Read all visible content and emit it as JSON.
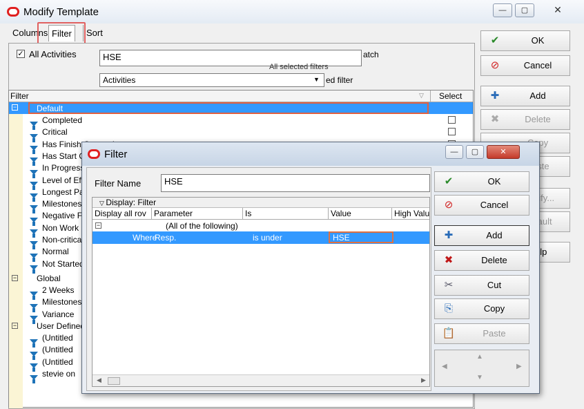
{
  "window": {
    "title": "Modify Template",
    "min": "—",
    "max": "▢",
    "close": "✕"
  },
  "tabs": [
    "Columns",
    "Filter",
    "Sort"
  ],
  "filter_panel": {
    "all_activities_label": "All Activities",
    "all_activities_checked": "✓",
    "filter_text": "HSE",
    "match_fragment": "atch",
    "selected_filters_fragment": "All selected filters",
    "activities_value": "Activities",
    "ed_filter_fragment": "ed filter"
  },
  "grid": {
    "col_filter": "Filter",
    "col_select": "Select",
    "groups": [
      {
        "name": "Default",
        "items": [
          "Completed",
          "Critical",
          "Has Finish Constraint",
          "Has Start Constraint",
          "In Progress",
          "Level of Effort",
          "Longest Path",
          "Milestones",
          "Negative Float",
          "Non Work",
          "Non-critical",
          "Normal",
          "Not Started"
        ]
      },
      {
        "name": "Global",
        "items": [
          "2 Weeks",
          "Milestones",
          "Variance"
        ]
      },
      {
        "name": "User Defined",
        "items": [
          "(Untitled",
          "(Untitled",
          "(Untitled",
          "stevie on"
        ]
      }
    ]
  },
  "side_buttons": [
    {
      "label": "OK",
      "icon": "✔"
    },
    {
      "label": "Cancel",
      "icon": "⊘"
    },
    {
      "label": "Add",
      "icon": "✚"
    },
    {
      "label": "Delete",
      "icon": "✖"
    },
    {
      "label": "Copy",
      "icon": ""
    },
    {
      "label": "Paste",
      "icon": ""
    },
    {
      "label": "Modify...",
      "icon": ""
    },
    {
      "label": "Default",
      "icon": ""
    },
    {
      "label": "Help",
      "icon": ""
    }
  ],
  "filter_dialog": {
    "title": "Filter",
    "name_label": "Filter Name",
    "name_value": "HSE",
    "display_header": "Display: Filter",
    "columns": [
      "Display all rov",
      "Parameter",
      "Is",
      "Value",
      "High Valu"
    ],
    "rows": [
      {
        "col1": "",
        "parameter": "(All of the following)",
        "is": "",
        "value": ""
      },
      {
        "col1": "Where",
        "parameter": "Resp.",
        "is": "is under",
        "value": "HSE"
      }
    ],
    "buttons": [
      {
        "label": "OK",
        "icon": "✔"
      },
      {
        "label": "Cancel",
        "icon": "⊘"
      },
      {
        "label": "Add",
        "icon": "✚"
      },
      {
        "label": "Delete",
        "icon": "✖"
      },
      {
        "label": "Cut",
        "icon": "✂"
      },
      {
        "label": "Copy",
        "icon": "⎘"
      },
      {
        "label": "Paste",
        "icon": "📋"
      }
    ],
    "min": "—",
    "max": "▢",
    "close": "✕"
  },
  "colors": {
    "selection": "#3399ff",
    "highlight_border": "#e06060",
    "accent": "#e02020"
  }
}
